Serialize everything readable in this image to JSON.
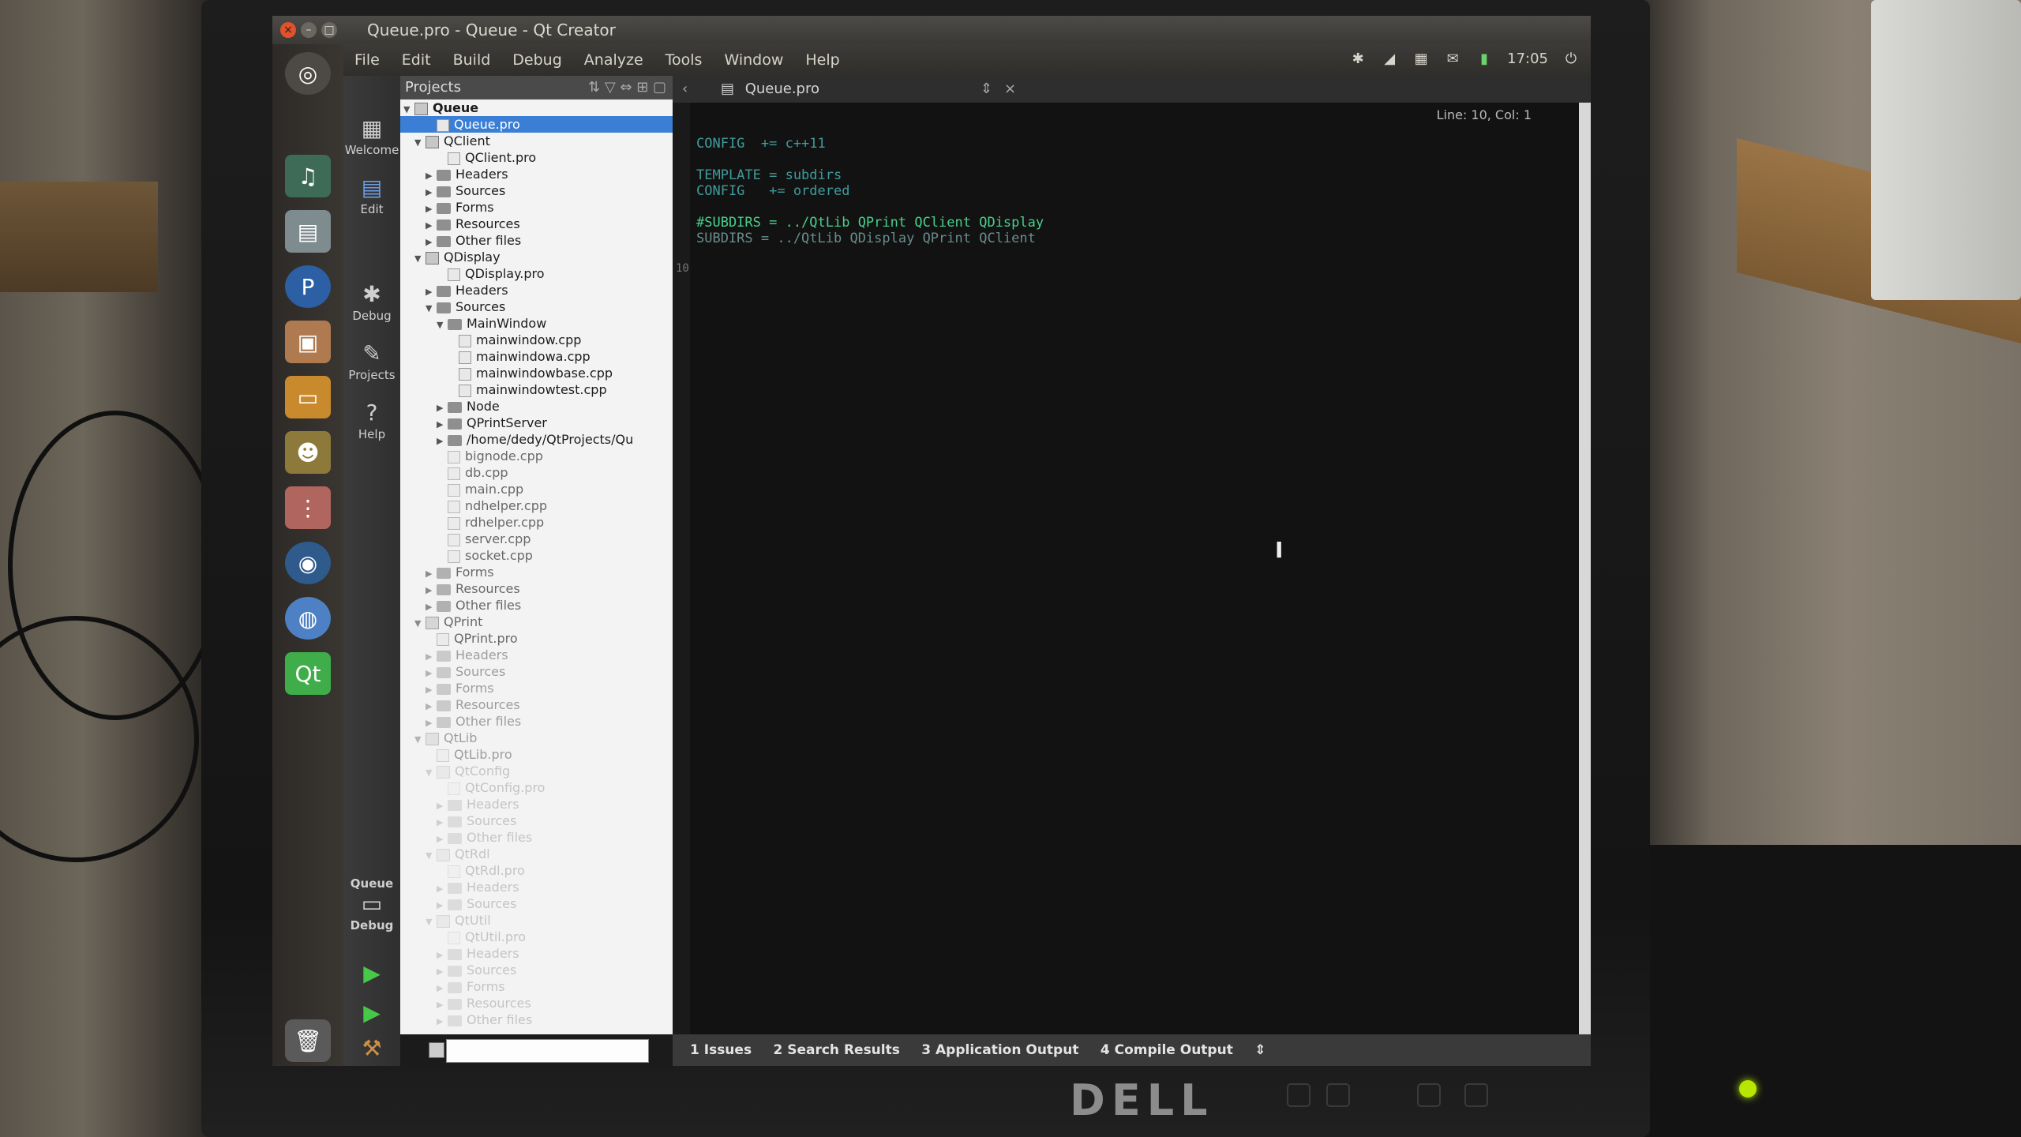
{
  "window": {
    "title": "Queue.pro - Queue - Qt Creator",
    "controls": [
      "×",
      "–",
      "□"
    ]
  },
  "menu": [
    "File",
    "Edit",
    "Build",
    "Debug",
    "Analyze",
    "Tools",
    "Window",
    "Help"
  ],
  "tray": {
    "icons": [
      "bluetooth-icon",
      "network-icon",
      "keyboard-icon",
      "mail-icon",
      "battery-icon"
    ],
    "clock": "17:05"
  },
  "launcher": {
    "apps": [
      "dash-icon",
      "music-icon",
      "files-icon",
      "pidgin-icon",
      "photos-icon",
      "notes-icon",
      "gimp-icon",
      "equalizer-icon",
      "browser-icon",
      "chrome-icon",
      "qt-creator-icon",
      "trash-icon"
    ]
  },
  "modes": {
    "welcome": "Welcome",
    "edit": "Edit",
    "debug": "Debug",
    "projects": "Projects",
    "help": "Help",
    "kit_project": "Queue",
    "kit_config": "Debug"
  },
  "projects_panel": {
    "header": "Projects",
    "tree": [
      "Queue",
      "Queue.pro",
      "QClient",
      "QClient.pro",
      "Headers",
      "Sources",
      "Forms",
      "Resources",
      "Other files",
      "QDisplay",
      "QDisplay.pro",
      "Headers",
      "Sources",
      "MainWindow",
      "mainwindow.cpp",
      "mainwindowa.cpp",
      "mainwindowbase.cpp",
      "mainwindowtest.cpp",
      "Node",
      "QPrintServer",
      "/home/dedy/QtProjects/Qu",
      "bignode.cpp",
      "db.cpp",
      "main.cpp",
      "ndhelper.cpp",
      "rdhelper.cpp",
      "server.cpp",
      "socket.cpp",
      "Forms",
      "Resources",
      "Other files",
      "QPrint",
      "QPrint.pro",
      "Headers",
      "Sources",
      "Forms",
      "Resources",
      "Other files",
      "QtLib",
      "QtLib.pro",
      "QtConfig",
      "QtConfig.pro",
      "Headers",
      "Sources",
      "Other files",
      "QtRdl",
      "QtRdl.pro",
      "Headers",
      "Sources",
      "QtUtil",
      "QtUtil.pro",
      "Headers",
      "Sources",
      "Forms",
      "Resources",
      "Other files"
    ]
  },
  "editor": {
    "tab": "Queue.pro",
    "cursor_position": "Line: 10, Col: 1",
    "code": [
      "CONFIG  += c++11",
      "",
      "TEMPLATE = subdirs",
      "CONFIG   += ordered",
      "",
      "#SUBDIRS = ../QtLib QPrint QClient QDisplay",
      "SUBDIRS = ../QtLib QDisplay QPrint QClient",
      "",
      "",
      ""
    ],
    "line_number_shown": "10",
    "colors": {
      "keyword": "#4fc9c9",
      "comment": "#48d08a",
      "dim": "#6a8c8c"
    }
  },
  "output": {
    "tabs": [
      "1  Issues",
      "2  Search Results",
      "3  Application Output",
      "4  Compile Output"
    ],
    "more": "⇕"
  },
  "monitor": {
    "brand": "DELL"
  }
}
